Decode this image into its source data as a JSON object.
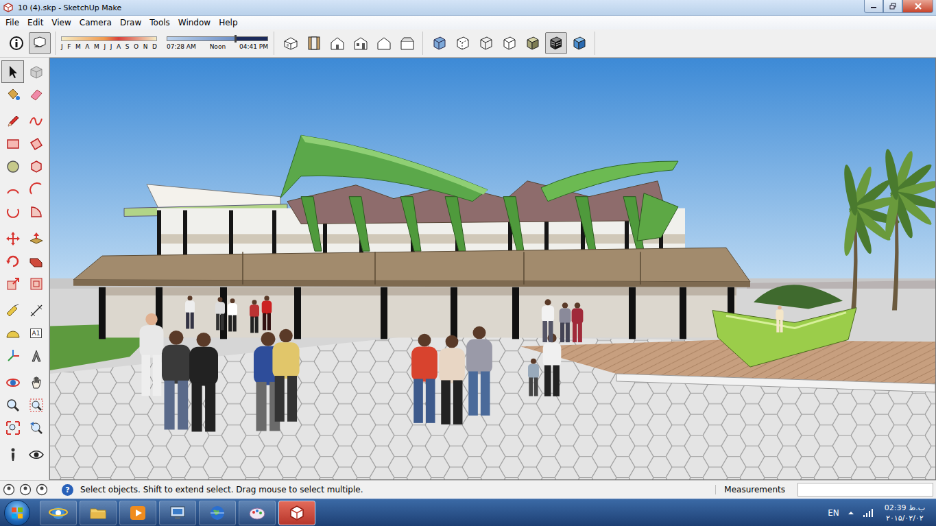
{
  "window": {
    "title": "10 (4).skp - SketchUp Make"
  },
  "menu": [
    "File",
    "Edit",
    "View",
    "Camera",
    "Draw",
    "Tools",
    "Window",
    "Help"
  ],
  "toolbar": {
    "left": [
      {
        "kind": "info",
        "selected": false
      },
      {
        "kind": "shadows",
        "selected": true
      }
    ],
    "shadow": {
      "months": [
        "J",
        "F",
        "M",
        "A",
        "M",
        "J",
        "J",
        "A",
        "S",
        "O",
        "N",
        "D"
      ],
      "times": [
        "07:28 AM",
        "Noon",
        "04:41 PM"
      ],
      "time_level": 0.67
    },
    "views": [
      {
        "kind": "iso",
        "selected": false
      },
      {
        "kind": "top",
        "selected": false
      },
      {
        "kind": "front",
        "selected": false
      },
      {
        "kind": "right",
        "selected": false
      },
      {
        "kind": "back",
        "selected": false
      },
      {
        "kind": "left",
        "selected": false
      }
    ],
    "styles": [
      {
        "kind": "xray",
        "selected": false
      },
      {
        "kind": "backedges",
        "selected": false
      },
      {
        "kind": "wireframe",
        "selected": false
      },
      {
        "kind": "hiddenline",
        "selected": false
      },
      {
        "kind": "shaded",
        "selected": false
      },
      {
        "kind": "textured",
        "selected": true
      },
      {
        "kind": "monochrome",
        "selected": false
      }
    ]
  },
  "palette": [
    [
      {
        "kind": "select",
        "selected": true
      },
      {
        "kind": "component",
        "selected": false
      },
      {
        "kind": "paint",
        "selected": false
      },
      {
        "kind": "eraser",
        "selected": false
      }
    ],
    [
      {
        "kind": "pencil",
        "selected": false
      },
      {
        "kind": "freehand",
        "selected": false
      },
      {
        "kind": "rectangle",
        "selected": false
      },
      {
        "kind": "rotrect",
        "selected": false
      },
      {
        "kind": "circle",
        "selected": false
      },
      {
        "kind": "polygon",
        "selected": false
      },
      {
        "kind": "arc",
        "selected": false
      },
      {
        "kind": "arc2",
        "selected": false
      },
      {
        "kind": "arc3",
        "selected": false
      },
      {
        "kind": "pie",
        "selected": false
      }
    ],
    [
      {
        "kind": "move",
        "selected": false
      },
      {
        "kind": "pushpull",
        "selected": false
      },
      {
        "kind": "rotate",
        "selected": false
      },
      {
        "kind": "followme",
        "selected": false
      },
      {
        "kind": "scale",
        "selected": false
      },
      {
        "kind": "offset",
        "selected": false
      }
    ],
    [
      {
        "kind": "tape",
        "selected": false
      },
      {
        "kind": "dimension",
        "selected": false
      },
      {
        "kind": "protractor",
        "selected": false
      },
      {
        "kind": "text",
        "selected": false,
        "label": "A1"
      },
      {
        "kind": "axes",
        "selected": false
      },
      {
        "kind": "text3d",
        "selected": false
      }
    ],
    [
      {
        "kind": "orbit",
        "selected": false
      },
      {
        "kind": "pan",
        "selected": false
      },
      {
        "kind": "zoom",
        "selected": false
      },
      {
        "kind": "zoomwindow",
        "selected": false
      },
      {
        "kind": "zoomextents",
        "selected": false
      },
      {
        "kind": "previous",
        "selected": false
      }
    ],
    [
      {
        "kind": "position",
        "selected": false
      },
      {
        "kind": "lookaround",
        "selected": false
      }
    ]
  ],
  "status_bar": {
    "help_glyph": "?",
    "text": "Select objects. Shift to extend select. Drag mouse to select multiple.",
    "measurements_label": "Measurements"
  },
  "taskbar": {
    "apps": [
      {
        "kind": "ie",
        "selected": false
      },
      {
        "kind": "explorer",
        "selected": false
      },
      {
        "kind": "media",
        "selected": false
      },
      {
        "kind": "network",
        "selected": false
      },
      {
        "kind": "earth",
        "selected": false
      },
      {
        "kind": "paint",
        "selected": false
      },
      {
        "kind": "sketchup",
        "selected": true
      }
    ],
    "language": "EN",
    "time": "02:39 ب.ظ",
    "date": "۲۰۱۵/۰۲/۰۲"
  }
}
